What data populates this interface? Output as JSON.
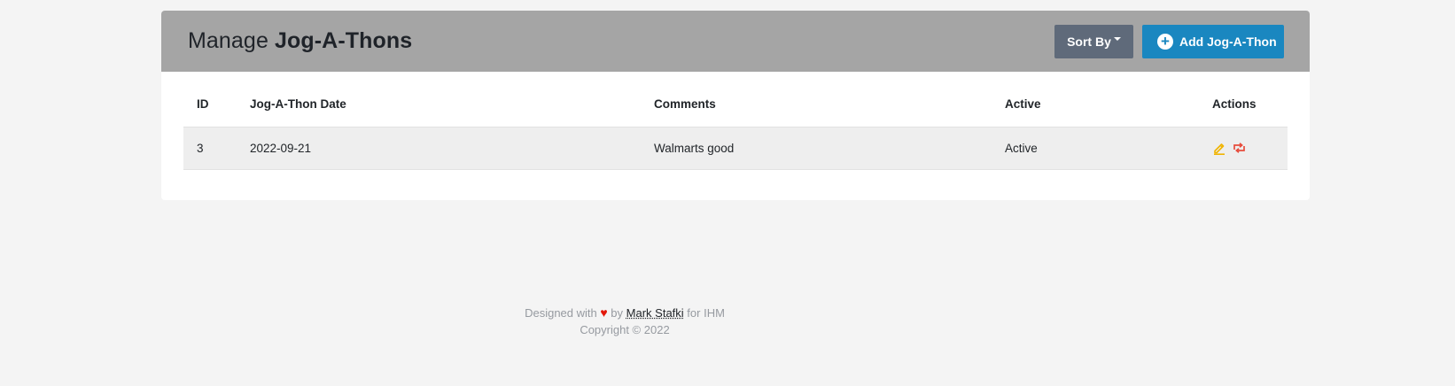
{
  "header": {
    "title_prefix": "Manage",
    "title_bold": "Jog-A-Thons",
    "sort_button_label": "Sort By",
    "add_button_label": "Add Jog-A-Thon"
  },
  "table": {
    "columns": [
      "ID",
      "Jog-A-Thon Date",
      "Comments",
      "Active",
      "Actions"
    ],
    "rows": [
      {
        "id": "3",
        "date": "2022-09-21",
        "comments": "Walmarts good",
        "active": "Active"
      }
    ]
  },
  "footer": {
    "designed_with": "Designed with",
    "heart": "♥",
    "by": "by",
    "author": "Mark Stafki",
    "for_text": "for IHM",
    "copyright": "Copyright © 2022"
  },
  "colors": {
    "header_bg": "#a5a5a5",
    "sort_button": "#5f6a7a",
    "add_button": "#1a87c0",
    "edit_icon": "#f0b400",
    "repost_icon": "#e74c3c",
    "heart": "#e3170a"
  },
  "icons": {
    "add": "plus-circle-icon",
    "edit": "pencil-icon",
    "repost": "repeat-icon"
  }
}
